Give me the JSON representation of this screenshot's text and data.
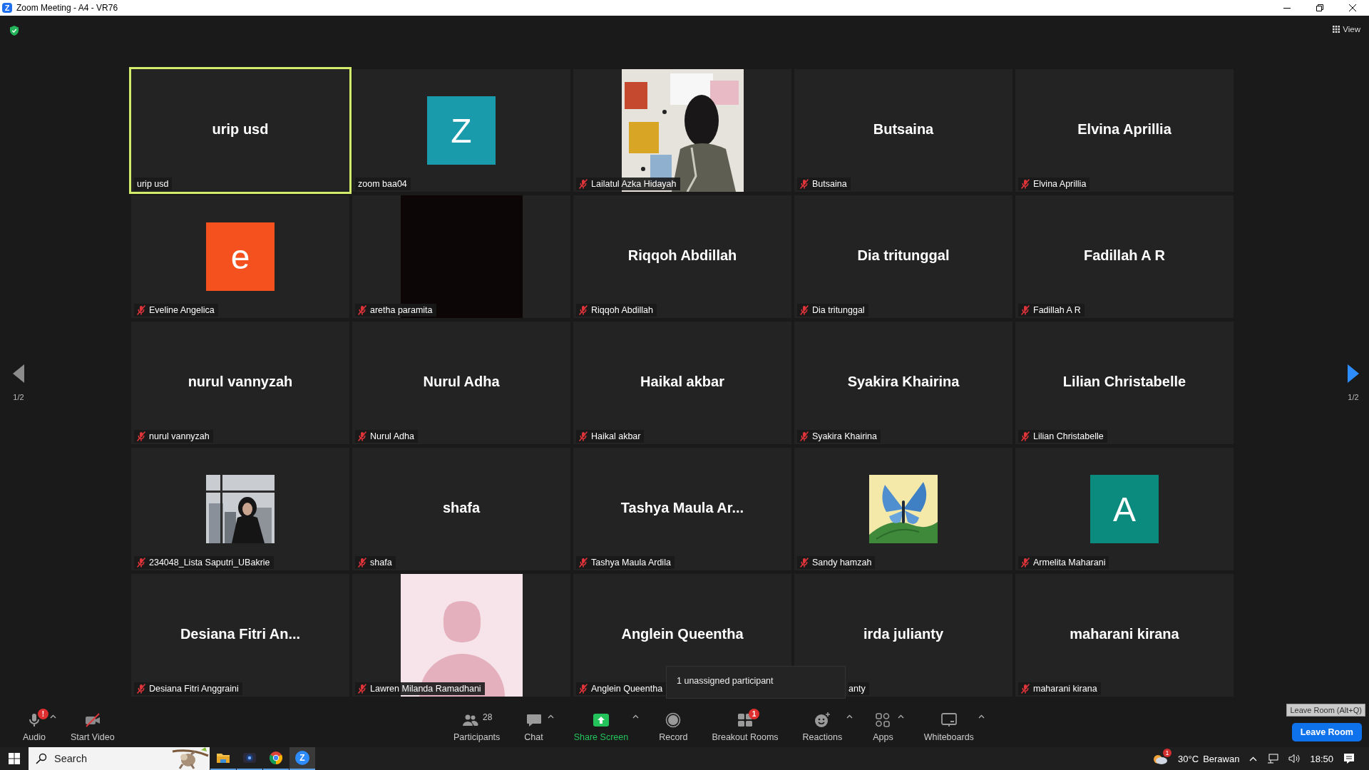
{
  "window": {
    "logo": "Z",
    "title": "Zoom Meeting - A4 - VR76"
  },
  "view_button": {
    "label": "View"
  },
  "pager": {
    "left": "1/2",
    "right": "1/2"
  },
  "tiles": [
    {
      "kind": "name",
      "display": "urip usd",
      "label": "urip usd",
      "muted": false,
      "speaking": true,
      "covered": false
    },
    {
      "kind": "avatar",
      "letter": "Z",
      "color": "#1a9bab",
      "label": "zoom baa04",
      "muted": false,
      "speaking": false,
      "covered": false
    },
    {
      "label": "Lailatul Azka Hidayah",
      "muted": true,
      "speaking": false,
      "covered": false
    },
    {
      "kind": "name",
      "display": "Butsaina",
      "label": "Butsaina",
      "muted": true,
      "speaking": false,
      "covered": false
    },
    {
      "kind": "name",
      "display": "Elvina Aprillia",
      "label": "Elvina Aprillia",
      "muted": true,
      "speaking": false,
      "covered": false
    },
    {
      "kind": "avatar",
      "letter": "e",
      "color": "#f4511e",
      "label": "Eveline Angelica",
      "muted": true,
      "speaking": false,
      "covered": false
    },
    {
      "kind": "dark",
      "label": "aretha paramita",
      "muted": true,
      "speaking": false,
      "covered": false
    },
    {
      "kind": "name",
      "display": "Riqqoh Abdillah",
      "label": "Riqqoh Abdillah",
      "muted": true,
      "speaking": false,
      "covered": false
    },
    {
      "kind": "name",
      "display": "Dia tritunggal",
      "label": "Dia tritunggal",
      "muted": true,
      "speaking": false,
      "covered": false
    },
    {
      "kind": "name",
      "display": "Fadillah A R",
      "label": "Fadillah A R",
      "muted": true,
      "speaking": false,
      "covered": false
    },
    {
      "kind": "name",
      "display": "nurul vannyzah",
      "label": "nurul vannyzah",
      "muted": true,
      "speaking": false,
      "covered": false
    },
    {
      "kind": "name",
      "display": "Nurul Adha",
      "label": "Nurul Adha",
      "muted": true,
      "speaking": false,
      "covered": false
    },
    {
      "kind": "name",
      "display": "Haikal akbar",
      "label": "Haikal akbar",
      "muted": true,
      "speaking": false,
      "covered": false
    },
    {
      "kind": "name",
      "display": "Syakira Khairina",
      "label": "Syakira Khairina",
      "muted": true,
      "speaking": false,
      "covered": false
    },
    {
      "kind": "name",
      "display": "Lilian Christabelle",
      "label": "Lilian Christabelle",
      "muted": true,
      "speaking": false,
      "covered": false
    },
    {
      "label": "234048_Lista Saputri_UBakrie",
      "muted": true,
      "speaking": false,
      "covered": false
    },
    {
      "kind": "name",
      "display": "shafa",
      "label": "shafa",
      "muted": true,
      "speaking": false,
      "covered": false
    },
    {
      "kind": "name",
      "display": "Tashya Maula Ar...",
      "label": "Tashya Maula Ardila",
      "muted": true,
      "speaking": false,
      "covered": false
    },
    {
      "label": "Sandy hamzah",
      "muted": true,
      "speaking": false,
      "covered": false
    },
    {
      "kind": "avatar",
      "letter": "A",
      "color": "#0b8a7e",
      "label": "Armelita Maharani",
      "muted": true,
      "speaking": false,
      "covered": false
    },
    {
      "kind": "name",
      "display": "Desiana Fitri An...",
      "label": "Desiana Fitri Anggraini",
      "muted": true,
      "speaking": false,
      "covered": false
    },
    {
      "kind": "placeholder",
      "label": "Lawren Milanda Ramadhani",
      "muted": true,
      "speaking": false,
      "covered": false
    },
    {
      "kind": "name",
      "display": "Anglein Queentha",
      "label": "Anglein Queentha",
      "muted": true,
      "speaking": false,
      "covered": false
    },
    {
      "kind": "name",
      "display": "irda julianty",
      "label": "anty",
      "muted": false,
      "speaking": false,
      "covered": true
    },
    {
      "kind": "name",
      "display": "maharani kirana",
      "label": "maharani kirana",
      "muted": true,
      "speaking": false,
      "covered": false
    }
  ],
  "tooltip": "1 unassigned participant",
  "toolbar": [
    {
      "kind": "audio",
      "label": "Audio",
      "badge": "!",
      "caret": true
    },
    {
      "kind": "video",
      "label": "Start Video",
      "caret": false
    },
    {
      "kind": "participants",
      "label": "Participants",
      "count": "28",
      "caret": false
    },
    {
      "kind": "chat",
      "label": "Chat",
      "caret": true
    },
    {
      "kind": "share",
      "label": "Share Screen",
      "caret": true
    },
    {
      "kind": "record",
      "label": "Record",
      "caret": false
    },
    {
      "kind": "breakout",
      "label": "Breakout Rooms",
      "badge": "1",
      "caret": false
    },
    {
      "kind": "reactions",
      "label": "Reactions",
      "caret": true
    },
    {
      "kind": "apps",
      "label": "Apps",
      "caret": true
    },
    {
      "kind": "whiteboards",
      "label": "Whiteboards",
      "caret": true
    }
  ],
  "leave": {
    "label": "Leave Room",
    "tooltip": "Leave Room (Alt+Q)"
  },
  "taskbar": {
    "search_placeholder": "Search",
    "apps": [
      {
        "kind": "explorer",
        "selected": false
      },
      {
        "kind": "camera",
        "selected": false
      },
      {
        "kind": "chrome",
        "selected": false
      },
      {
        "kind": "zoom",
        "letter": "Z",
        "selected": true
      }
    ],
    "weather_badge": "1",
    "temperature": "30°C",
    "condition": "Berawan",
    "time": "18:50"
  }
}
